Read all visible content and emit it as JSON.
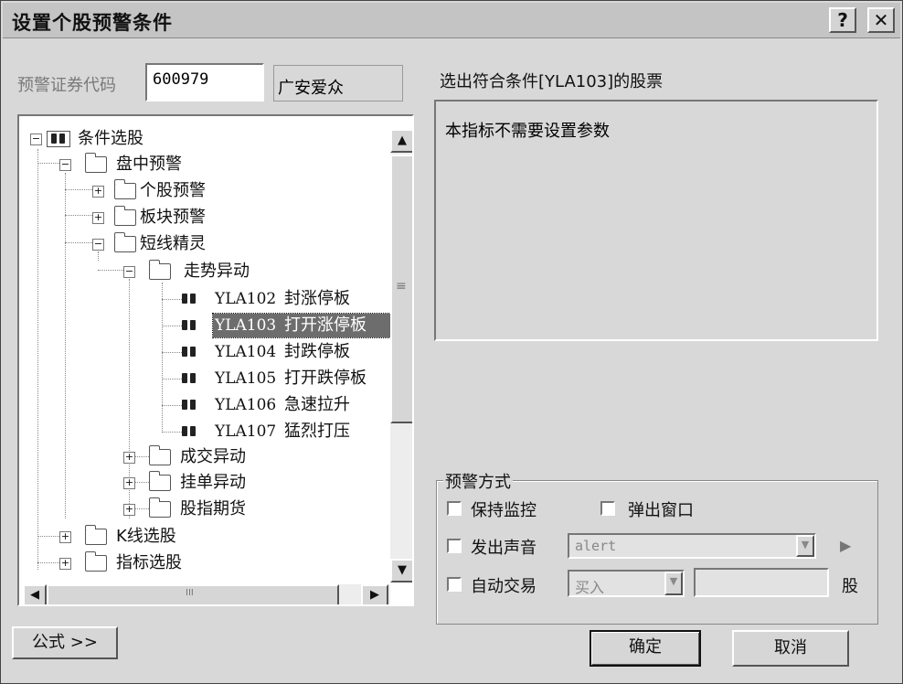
{
  "window": {
    "title": "设置个股预警条件",
    "help_glyph": "?",
    "close_glyph": "✕"
  },
  "stock": {
    "code_label": "预警证券代码",
    "code_value": "600979",
    "name_value": "广安爱众"
  },
  "tree": {
    "items": [
      {
        "label": "条件选股",
        "code": "",
        "icon": "binoculars-icon",
        "expander": "−"
      },
      {
        "label": "盘中预警",
        "code": "",
        "icon": "folder-icon",
        "expander": "−"
      },
      {
        "label": "个股预警",
        "code": "",
        "icon": "folder-icon",
        "expander": "+"
      },
      {
        "label": "板块预警",
        "code": "",
        "icon": "folder-icon",
        "expander": "+"
      },
      {
        "label": "短线精灵",
        "code": "",
        "icon": "folder-icon",
        "expander": "−"
      },
      {
        "label": "走势异动",
        "code": "",
        "icon": "folder-icon",
        "expander": "−"
      },
      {
        "label": "封涨停板",
        "code": "YLA102",
        "icon": "binoculars-icon",
        "expander": ""
      },
      {
        "label": "打开涨停板",
        "code": "YLA103",
        "icon": "binoculars-icon",
        "expander": "",
        "selected": true
      },
      {
        "label": "封跌停板",
        "code": "YLA104",
        "icon": "binoculars-icon",
        "expander": ""
      },
      {
        "label": "打开跌停板",
        "code": "YLA105",
        "icon": "binoculars-icon",
        "expander": ""
      },
      {
        "label": "急速拉升",
        "code": "YLA106",
        "icon": "binoculars-icon",
        "expander": ""
      },
      {
        "label": "猛烈打压",
        "code": "YLA107",
        "icon": "binoculars-icon",
        "expander": ""
      },
      {
        "label": "成交异动",
        "code": "",
        "icon": "folder-icon",
        "expander": "+"
      },
      {
        "label": "挂单异动",
        "code": "",
        "icon": "folder-icon",
        "expander": "+"
      },
      {
        "label": "股指期货",
        "code": "",
        "icon": "folder-icon",
        "expander": "+"
      },
      {
        "label": "K线选股",
        "code": "",
        "icon": "folder-icon",
        "expander": "+"
      },
      {
        "label": "指标选股",
        "code": "",
        "icon": "folder-icon",
        "expander": "+"
      }
    ],
    "scroll_up_glyph": "▲",
    "scroll_down_glyph": "▼",
    "scroll_left_glyph": "◀",
    "scroll_right_glyph": "▶",
    "grip_v_glyph": "≡",
    "grip_h_glyph": "III"
  },
  "detail": {
    "header": "选出符合条件[YLA103]的股票",
    "param_text": "本指标不需要设置参数"
  },
  "alert": {
    "group_label": "预警方式",
    "keep_monitor_label": "保持监控",
    "popup_window_label": "弹出窗口",
    "sound_label": "发出声音",
    "sound_value": "alert",
    "play_glyph": "▶",
    "auto_trade_label": "自动交易",
    "trade_direction_value": "买入",
    "quantity_value": "",
    "quantity_unit": "股",
    "dropdown_glyph": "▼"
  },
  "footer": {
    "formula_label": "公式 >>",
    "ok_label": "确定",
    "cancel_label": "取消"
  },
  "colors": {
    "dialog_bg": "#d8d8d8",
    "titlebar_bg": "#c4c4c4",
    "selection_bg": "#6d6d6d"
  }
}
